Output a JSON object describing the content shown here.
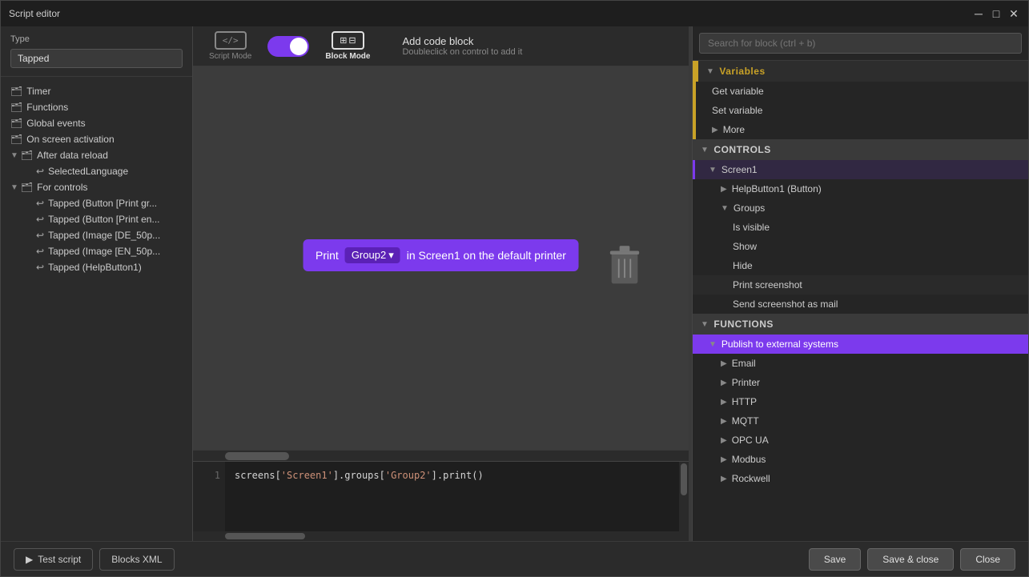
{
  "window": {
    "title": "Script editor"
  },
  "titlebar": {
    "title": "Script editor",
    "minimize_label": "─",
    "restore_label": "□",
    "close_label": "✕"
  },
  "type_section": {
    "label": "Type",
    "value": "Tapped"
  },
  "tree": {
    "items": [
      {
        "id": "timer",
        "label": "Timer",
        "indent": 0,
        "icon": "📁",
        "expandable": false
      },
      {
        "id": "functions",
        "label": "Functions",
        "indent": 0,
        "icon": "📁",
        "expandable": false
      },
      {
        "id": "global-events",
        "label": "Global events",
        "indent": 0,
        "icon": "📁",
        "expandable": false
      },
      {
        "id": "on-screen",
        "label": "On screen activation",
        "indent": 0,
        "icon": "📁",
        "expandable": false
      },
      {
        "id": "after-data-reload",
        "label": "After data reload",
        "indent": 0,
        "icon": "📁",
        "expandable": true,
        "expanded": true
      },
      {
        "id": "selected-language",
        "label": "SelectedLanguage",
        "indent": 1,
        "icon": "↩",
        "expandable": false
      },
      {
        "id": "for-controls",
        "label": "For controls",
        "indent": 0,
        "icon": "📁",
        "expandable": true,
        "expanded": true
      },
      {
        "id": "tapped-button-print1",
        "label": "Tapped (Button [Print gr...",
        "indent": 2,
        "icon": "↩",
        "expandable": false
      },
      {
        "id": "tapped-button-print2",
        "label": "Tapped (Button [Print en...",
        "indent": 2,
        "icon": "↩",
        "expandable": false
      },
      {
        "id": "tapped-image-de",
        "label": "Tapped (Image [DE_50p...",
        "indent": 2,
        "icon": "↩",
        "expandable": false
      },
      {
        "id": "tapped-image-en",
        "label": "Tapped (Image [EN_50p...",
        "indent": 2,
        "icon": "↩",
        "expandable": false
      },
      {
        "id": "tapped-helpbutton",
        "label": "Tapped (HelpButton1)",
        "indent": 2,
        "icon": "↩",
        "expandable": false
      }
    ]
  },
  "toolbar": {
    "script_mode_label": "Script Mode",
    "block_mode_label": "Block Mode",
    "script_mode_icon": "</>",
    "add_code_block_title": "Add code block",
    "add_code_block_subtitle": "Doubleclick on control to add it"
  },
  "canvas": {
    "print_block": {
      "label": "Print",
      "group": "Group2",
      "text": "in Screen1 on the default printer"
    }
  },
  "code_editor": {
    "lines": [
      {
        "number": "1",
        "code": "screens['Screen1'].groups['Group2'].print()"
      }
    ]
  },
  "search": {
    "placeholder": "Search for block (ctrl + b)"
  },
  "right_panel": {
    "variables_section": {
      "label": "Variables",
      "items": [
        {
          "label": "Get variable"
        },
        {
          "label": "Set variable"
        },
        {
          "label": "More"
        }
      ]
    },
    "controls_section": {
      "label": "CONTROLS",
      "items": [
        {
          "label": "Screen1",
          "selected": true,
          "indent": 1
        },
        {
          "label": "HelpButton1 (Button)",
          "indent": 2
        },
        {
          "label": "Groups",
          "indent": 2,
          "expandable": true
        },
        {
          "label": "Is visible",
          "indent": 3
        },
        {
          "label": "Show",
          "indent": 3
        },
        {
          "label": "Hide",
          "indent": 3
        },
        {
          "label": "Print screenshot",
          "indent": 3,
          "highlighted": true
        },
        {
          "label": "Send screenshot as mail",
          "indent": 3
        }
      ]
    },
    "functions_section": {
      "label": "FUNCTIONS",
      "items": [
        {
          "label": "Publish to external systems",
          "active": true,
          "indent": 1
        },
        {
          "label": "Email",
          "indent": 2
        },
        {
          "label": "Printer",
          "indent": 2
        },
        {
          "label": "HTTP",
          "indent": 2
        },
        {
          "label": "MQTT",
          "indent": 2
        },
        {
          "label": "OPC UA",
          "indent": 2
        },
        {
          "label": "Modbus",
          "indent": 2
        },
        {
          "label": "Rockwell",
          "indent": 2
        }
      ]
    }
  },
  "bottom_bar": {
    "test_script_label": "Test script",
    "blocks_xml_label": "Blocks XML",
    "save_label": "Save",
    "save_close_label": "Save & close",
    "close_label": "Close"
  }
}
